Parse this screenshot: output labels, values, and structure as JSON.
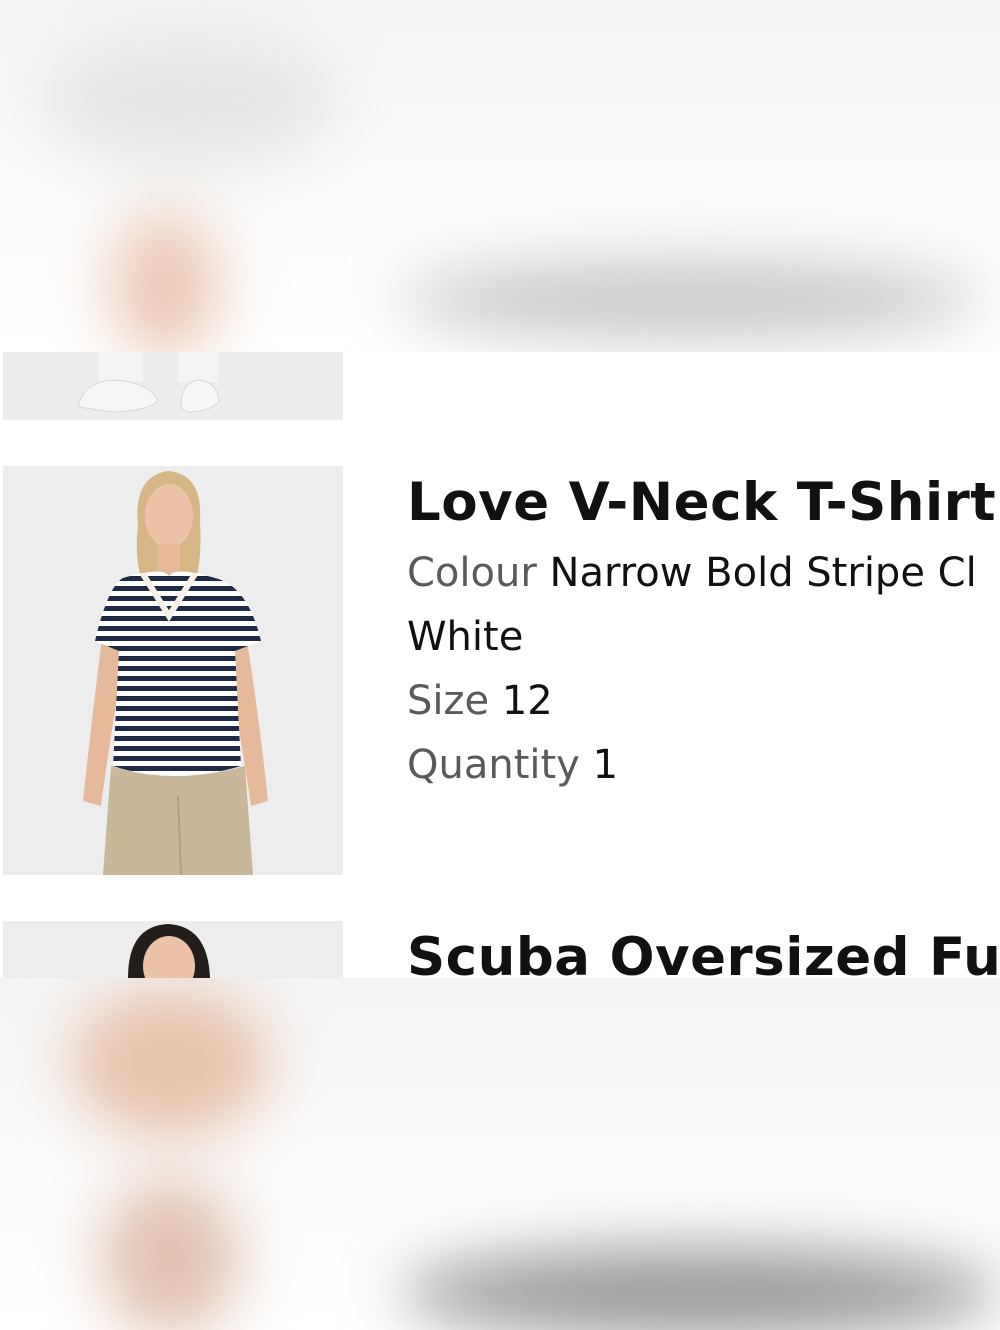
{
  "items": [
    {
      "title": "Love V-Neck T-Shirt",
      "colour_label": "Colour",
      "colour_value": "Narrow Bold Stripe Cl",
      "colour_value_cont": "White",
      "size_label": "Size",
      "size_value": "12",
      "quantity_label": "Quantity",
      "quantity_value": "1"
    },
    {
      "title": "Scuba Oversized Funn"
    }
  ],
  "colors": {
    "text": "#111111",
    "label": "#5a5a5a",
    "thumb_bg": "#ededee",
    "stripe": "#1f2a44",
    "pants": "#c9b79a",
    "skin": "#e8bfa5"
  }
}
